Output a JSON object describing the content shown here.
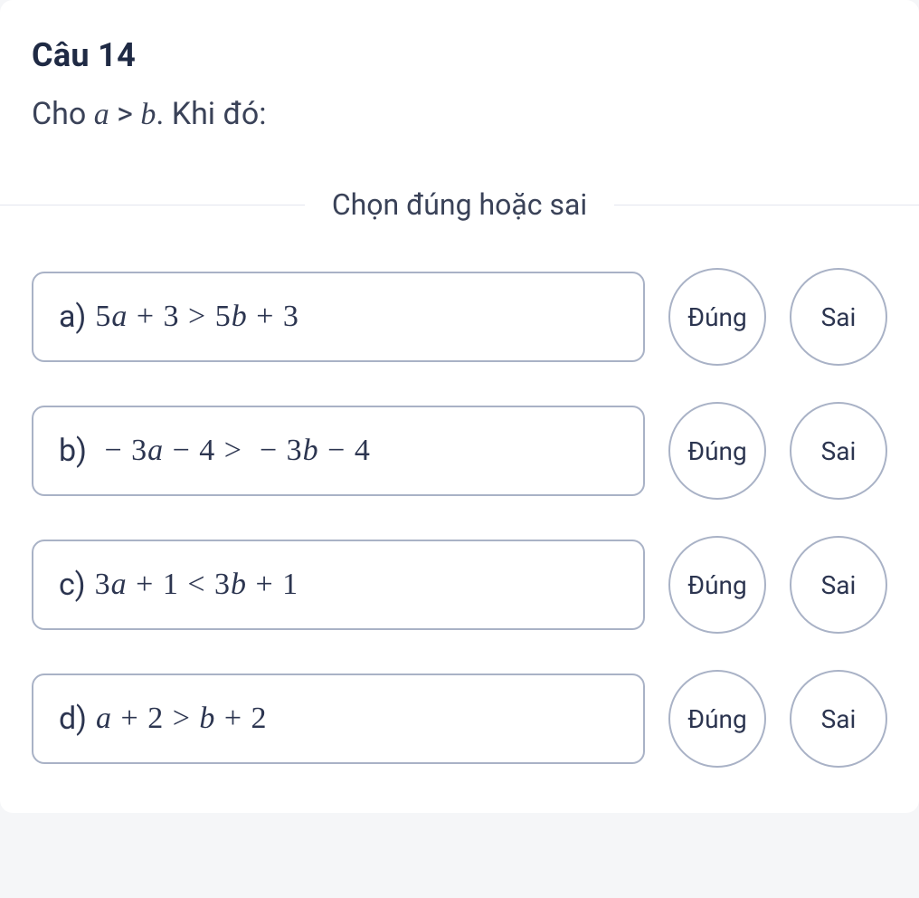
{
  "question": {
    "title": "Câu 14",
    "stem_prefix": "Cho ",
    "stem_math": "a > b",
    "stem_suffix": ". Khi đó:"
  },
  "instruction": "Chọn đúng hoặc sai",
  "labels": {
    "true": "Đúng",
    "false": "Sai"
  },
  "options": [
    {
      "letter": "a)",
      "math": "5a + 3 > 5b + 3"
    },
    {
      "letter": "b)",
      "math": "− 3a − 4 > − 3b − 4"
    },
    {
      "letter": "c)",
      "math": "3a + 1 < 3b + 1"
    },
    {
      "letter": "d)",
      "math": "a + 2 > b + 2"
    }
  ]
}
